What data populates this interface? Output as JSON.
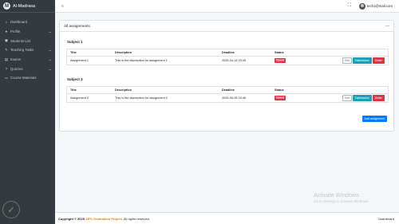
{
  "brand": {
    "logo_letter": "M",
    "name": "Al-Madrasa"
  },
  "sidebar": {
    "items": [
      {
        "icon": "⌂",
        "label": "Dashboard",
        "chevron": ""
      },
      {
        "icon": "●",
        "label": "Profile",
        "chevron": "⌄"
      },
      {
        "icon": "◼",
        "label": "Students List",
        "chevron": ""
      },
      {
        "icon": "✎",
        "label": "Teaching Tasks",
        "chevron": "⌄"
      },
      {
        "icon": "▤",
        "label": "Exams",
        "chevron": "⌄"
      },
      {
        "icon": "?",
        "label": "Quizzes",
        "chevron": "⌄"
      },
      {
        "icon": "▭",
        "label": "Course Materials",
        "chevron": ""
      }
    ]
  },
  "topbar": {
    "menu_icon": "≡",
    "fullscreen_icon": "⛶",
    "user_email": "tech1@mail.com"
  },
  "card": {
    "title": "All assignments",
    "collapse_icon": "—",
    "add_button": "Add assignment",
    "columns": {
      "title": "Title",
      "description": "Description",
      "deadline": "Deadline",
      "status": "Status"
    },
    "subjects": [
      {
        "name": "Subject 1",
        "rows": [
          {
            "title": "Assignment 1",
            "description": "This is the discreption for assignment 1",
            "deadline": "2025-04-14 03:45",
            "status": "Closed"
          }
        ]
      },
      {
        "name": "Subject 3",
        "rows": [
          {
            "title": "Assignment 2",
            "description": "This is the discreption for assignment 2",
            "deadline": "2025-05-05 04:46",
            "status": "Closed"
          }
        ]
      }
    ],
    "actions": {
      "edit": "Edit",
      "submissions": "Submissions",
      "delete": "Delete"
    }
  },
  "footer": {
    "copyright": "Copyright © 2025",
    "project": "2IPS Graduation Project",
    "rights": ". All rights reserved.",
    "right_text": "Dashboard"
  },
  "activation": {
    "title": "Activate Windows",
    "subtitle": "Go to Settings to activate Windows."
  },
  "colors": {
    "sidebar_bg": "#343a40",
    "primary": "#007bff",
    "info": "#17a2b8",
    "danger": "#dc3545",
    "footer_link": "#e87d00"
  }
}
